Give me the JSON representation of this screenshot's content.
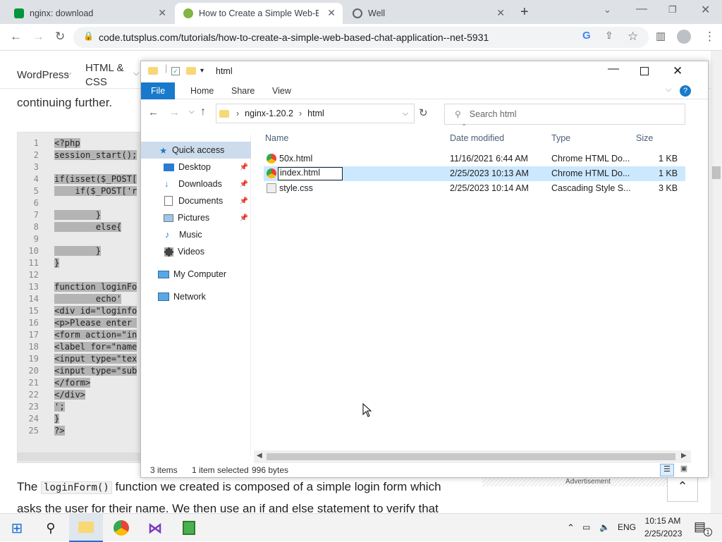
{
  "browser": {
    "tabs": [
      {
        "title": "nginx: download",
        "active": false
      },
      {
        "title": "How to Create a Simple Web-Ba",
        "active": true
      },
      {
        "title": "Well",
        "active": false
      }
    ],
    "url": "code.tutsplus.com/tutorials/how-to-create-a-simple-web-based-chat-application--net-5931"
  },
  "site": {
    "nav": [
      "WordPress",
      "HTML &",
      "CSS"
    ],
    "intro": "continuing further.",
    "code_lines": [
      "<?php",
      "session_start();",
      "",
      "if(isset($_POST[",
      "    if($_POST['r",
      "",
      "        }",
      "        else{",
      "",
      "        }",
      "}",
      "",
      "function loginFo",
      "        echo'",
      "<div id=\"loginfo",
      "<p>Please enter ",
      "<form action=\"in",
      "<label for=\"name",
      "<input type=\"tex",
      "<input type=\"sub",
      "</form>",
      "</div>",
      "';",
      "}",
      "?>"
    ],
    "body_pre": "The ",
    "body_code": "loginForm()",
    "body_post": " function we created is composed of a simple login form which asks the user for their name. We then use an if and else statement to verify that",
    "advert": "Advertisement"
  },
  "explorer": {
    "title": "html",
    "ribbon": [
      "File",
      "Home",
      "Share",
      "View"
    ],
    "path": [
      "nginx-1.20.2",
      "html"
    ],
    "search_placeholder": "Search html",
    "nav": [
      {
        "label": "Quick access",
        "pinned": false
      },
      {
        "label": "Desktop",
        "pinned": true
      },
      {
        "label": "Downloads",
        "pinned": true
      },
      {
        "label": "Documents",
        "pinned": true
      },
      {
        "label": "Pictures",
        "pinned": true
      },
      {
        "label": "Music",
        "pinned": false
      },
      {
        "label": "Videos",
        "pinned": false
      },
      {
        "label": "My Computer",
        "pinned": false
      },
      {
        "label": "Network",
        "pinned": false
      }
    ],
    "columns": [
      "Name",
      "Date modified",
      "Type",
      "Size"
    ],
    "files": [
      {
        "name": "50x.html",
        "date": "11/16/2021 6:44 AM",
        "type": "Chrome HTML Do...",
        "size": "1 KB"
      },
      {
        "name": "index.html",
        "date": "2/25/2023 10:13 AM",
        "type": "Chrome HTML Do...",
        "size": "1 KB"
      },
      {
        "name": "style.css",
        "date": "2/25/2023 10:14 AM",
        "type": "Cascading Style S...",
        "size": "3 KB"
      }
    ],
    "status_items": "3 items",
    "status_selected": "1 item selected",
    "status_size": "996 bytes"
  },
  "taskbar": {
    "lang": "ENG",
    "time": "10:15 AM",
    "date": "2/25/2023",
    "notifications": "1"
  }
}
